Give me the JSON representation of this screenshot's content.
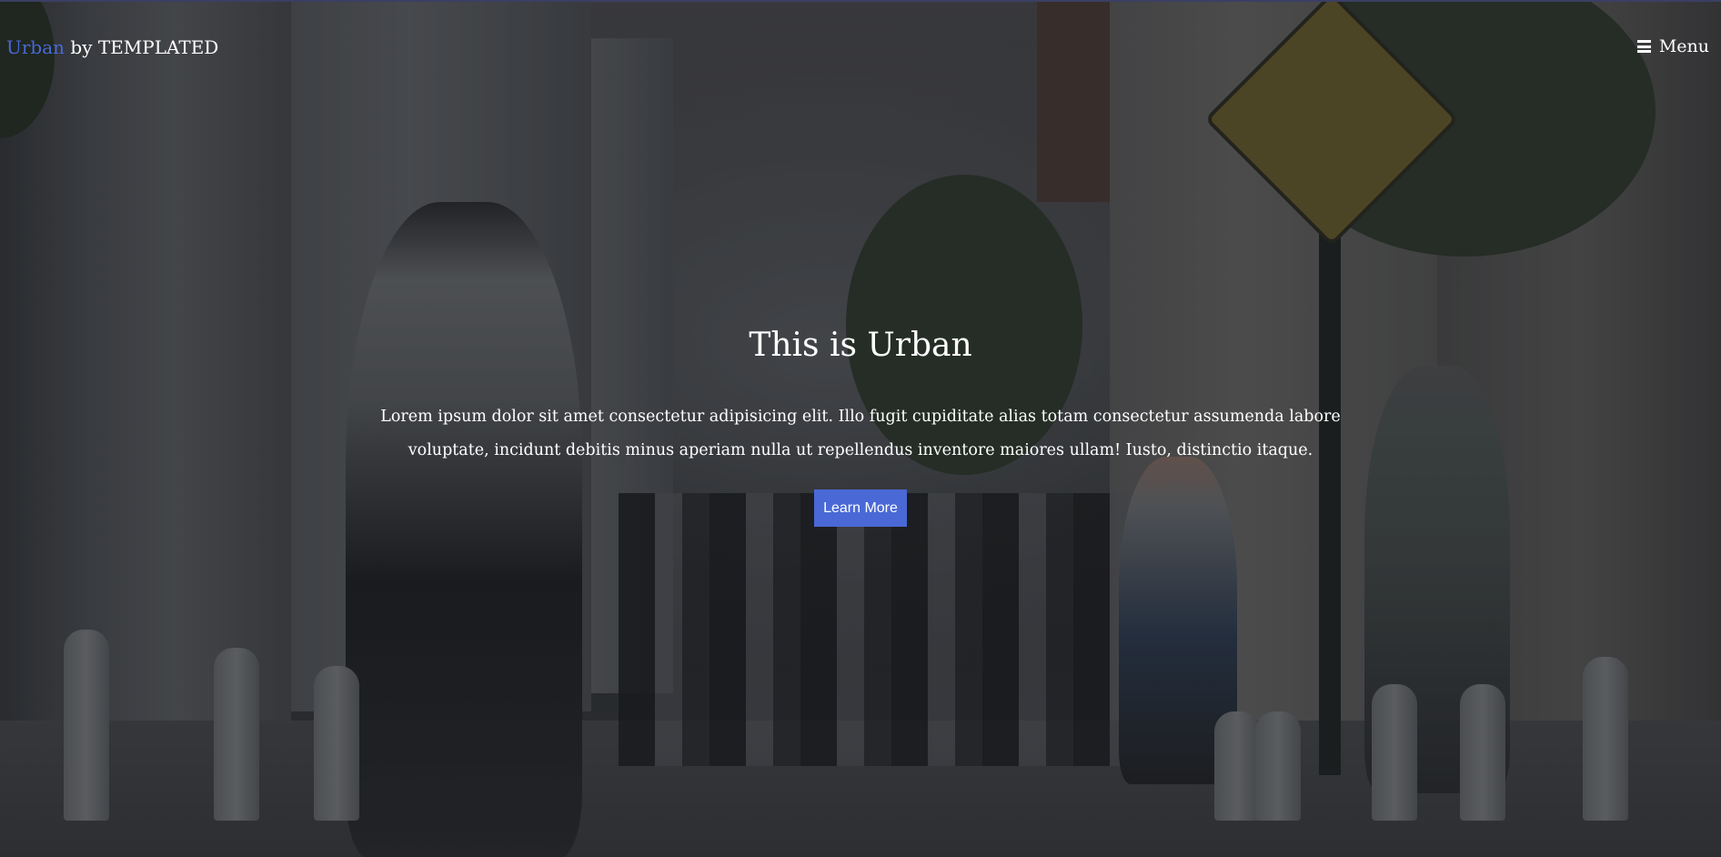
{
  "header": {
    "logo_brand": "Urban",
    "logo_rest": " by TEMPLATED",
    "menu_label": "Menu",
    "menu_icon": "hamburger-icon"
  },
  "banner": {
    "title": "This is Urban",
    "text": "Lorem ipsum dolor sit amet consectetur adipisicing elit. Illo fugit cupiditate alias totam consectetur assumenda labore voluptate, incidunt debitis minus aperiam nulla ut repellendus inventore maiores ullam! Iusto, distinctio itaque.",
    "button_label": "Learn More",
    "background": "city-street-photo"
  },
  "colors": {
    "accent": "#4a69d6",
    "text": "#ffffff"
  }
}
